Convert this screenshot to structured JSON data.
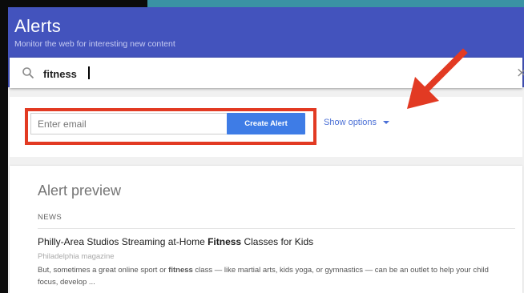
{
  "header": {
    "title": "Alerts",
    "subtitle": "Monitor the web for interesting new content"
  },
  "search": {
    "value": "fitness",
    "icon": "search-icon",
    "clear_icon": "close-icon"
  },
  "create_form": {
    "email_placeholder": "Enter email",
    "create_button_label": "Create Alert",
    "show_options_label": "Show options"
  },
  "preview": {
    "title": "Alert preview",
    "section_label": "NEWS",
    "article": {
      "title_before": "Philly-Area Studios Streaming at-Home ",
      "title_highlight": "Fitness",
      "title_after": " Classes for Kids",
      "source": "Philadelphia magazine",
      "snippet_part1": "But, sometimes a great online sport or ",
      "snippet_highlight": "fitness",
      "snippet_part2": " class — like martial arts, kids yoga, or gymnastics — can be an outlet to help your child focus, develop ..."
    }
  },
  "colors": {
    "header_bg": "#4353bd",
    "primary_button": "#3e7ce6",
    "annotation_red": "#e23a23",
    "link_blue": "#4a6fd6"
  }
}
